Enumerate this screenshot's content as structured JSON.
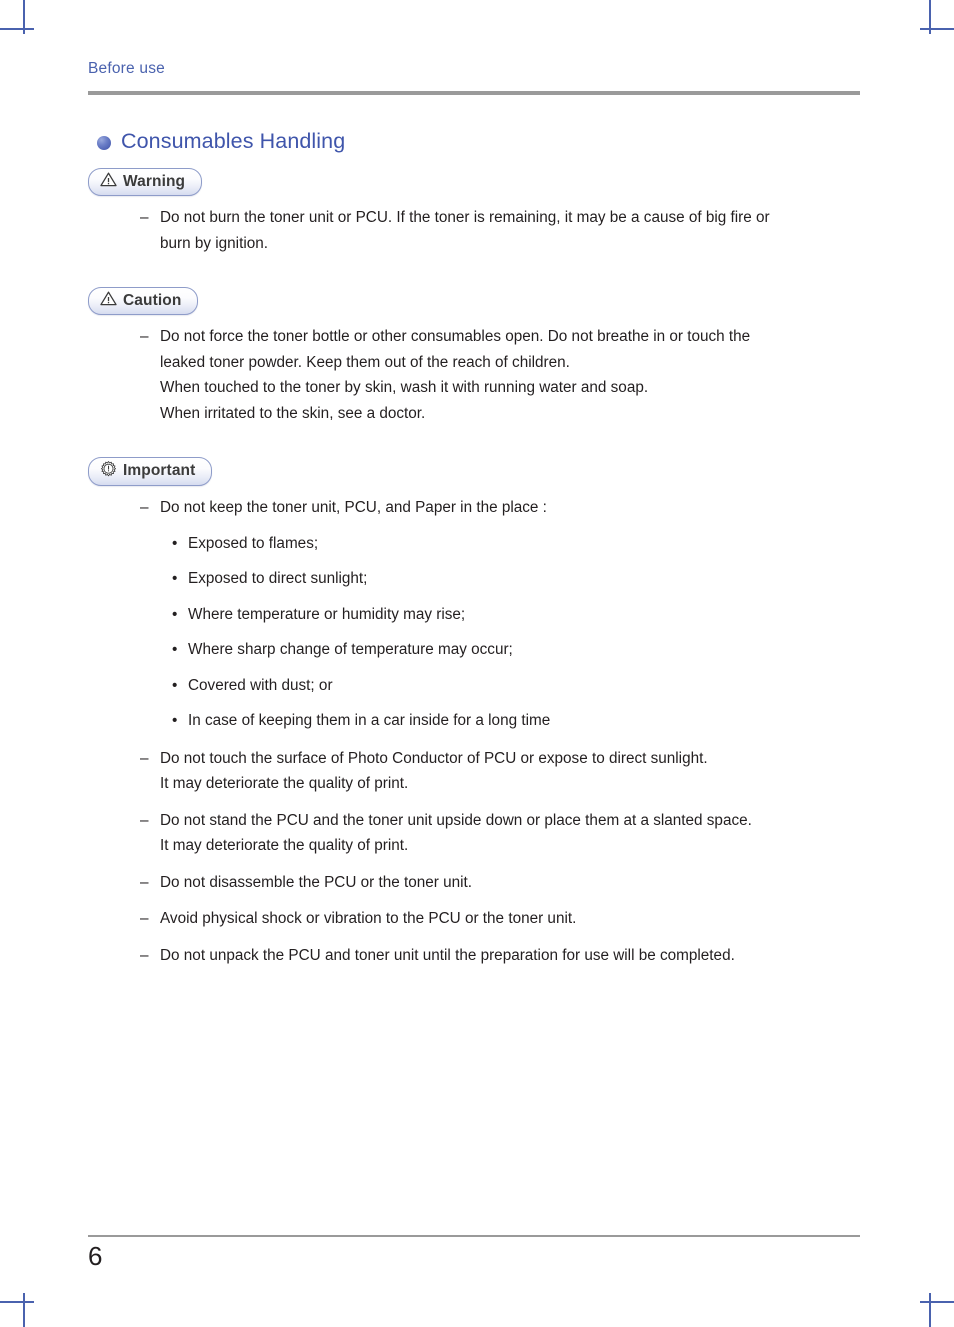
{
  "header": {
    "running_title": "Before use"
  },
  "section": {
    "title": "Consumables Handling",
    "bullet_icon": "filled-circle-icon"
  },
  "blocks": [
    {
      "badge": {
        "label": "Warning",
        "icon": "warning-triangle-icon"
      },
      "items": [
        {
          "marker": "–",
          "lines": [
            "Do not burn the toner unit or PCU. If the toner is remaining, it may be a cause of big fire or",
            "burn by ignition."
          ]
        }
      ]
    },
    {
      "badge": {
        "label": "Caution",
        "icon": "warning-triangle-icon"
      },
      "items": [
        {
          "marker": "–",
          "lines": [
            "Do not force the toner bottle or other consumables open.  Do not breathe in or touch the",
            "leaked toner powder. Keep them out of the reach of children.",
            "When touched to the toner by skin, wash it with running water and soap.",
            "When irritated to the skin, see a doctor."
          ]
        }
      ]
    },
    {
      "badge": {
        "label": "Important",
        "icon": "important-starburst-icon"
      },
      "items": [
        {
          "marker": "–",
          "lines": [
            "Do not keep the toner unit, PCU, and Paper in the place :"
          ]
        }
      ],
      "sub_bullets": {
        "marker": "•",
        "items": [
          "Exposed to flames;",
          "Exposed to direct sunlight;",
          "Where temperature or humidity may rise;",
          "Where sharp change of temperature may occur;",
          "Covered with dust; or",
          "In case of keeping them in a car inside for a long time"
        ]
      },
      "items_after": [
        {
          "marker": "–",
          "lines": [
            "Do not touch the surface of Photo Conductor of PCU or expose to direct sunlight.",
            "It may deteriorate the quality of print."
          ]
        },
        {
          "marker": "–",
          "lines": [
            "Do not stand the PCU and the toner unit upside down or place them at a slanted space.",
            "It may deteriorate the quality of print."
          ]
        },
        {
          "marker": "–",
          "lines": [
            "Do not disassemble the PCU or the toner unit."
          ]
        },
        {
          "marker": "–",
          "lines": [
            "Avoid physical shock or vibration to the PCU or the toner unit."
          ]
        },
        {
          "marker": "–",
          "lines": [
            "Do not unpack the PCU and toner unit until the preparation for use will be completed."
          ]
        }
      ]
    }
  ],
  "footer": {
    "page_number": "6"
  },
  "colors": {
    "header_blue": "#4a62ae",
    "heading_blue": "#3f55ab",
    "rule_gray": "#9a9a9a",
    "badge_border": "#8e9cc9",
    "body_text": "#231f20",
    "crop_mark": "#4a62ae"
  }
}
